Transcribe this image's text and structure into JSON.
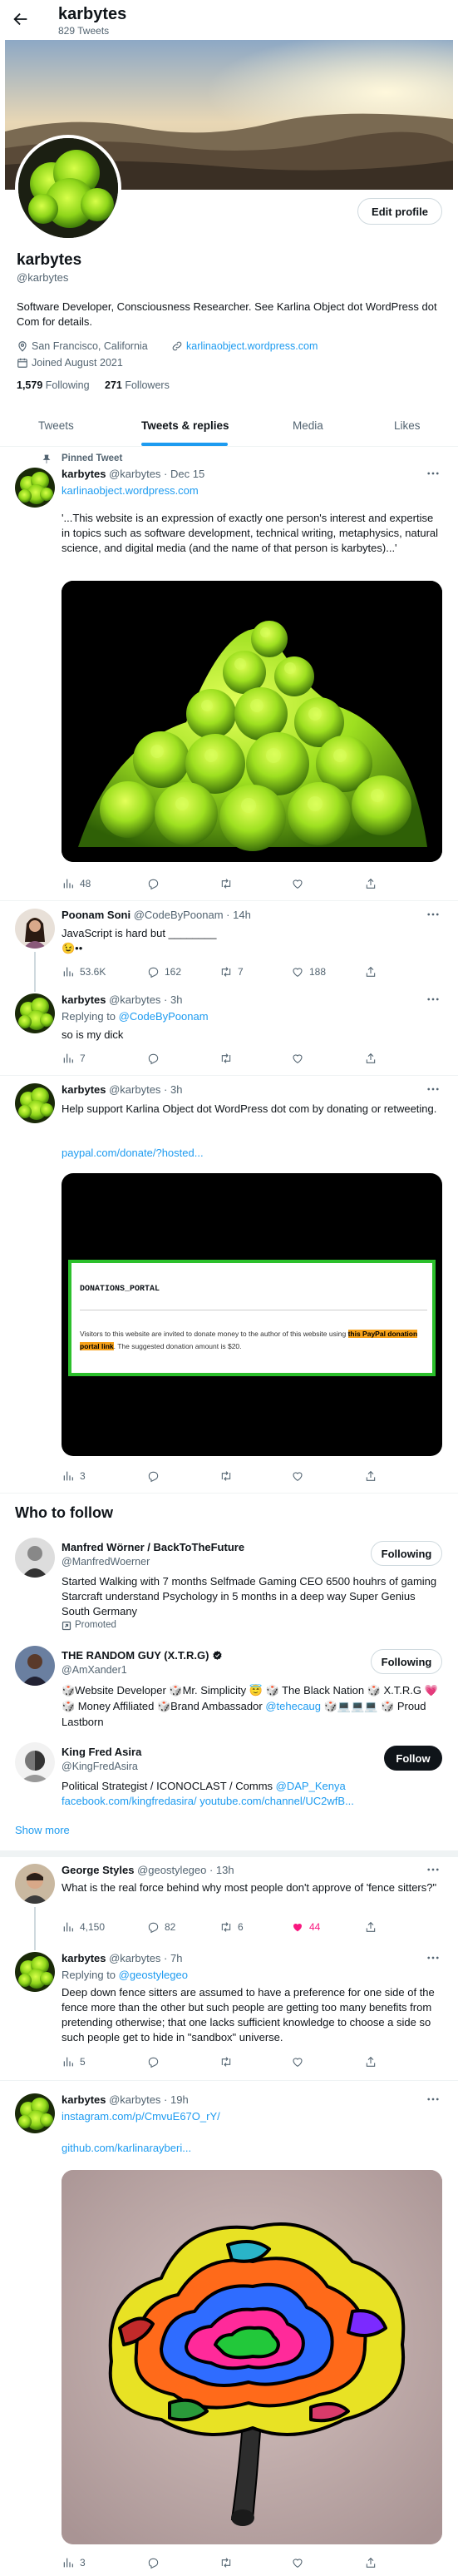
{
  "header": {
    "name": "karbytes",
    "tweet_count": "829 Tweets"
  },
  "profile": {
    "name": "karbytes",
    "handle": "@karbytes",
    "edit_label": "Edit profile",
    "bio": "Software Developer, Consciousness Researcher. See Karlina Object dot WordPress dot Com for details.",
    "location": "San Francisco, California",
    "website": "karlinaobject.wordpress.com",
    "joined": "Joined August 2021",
    "following_count": "1,579",
    "following_label": "Following",
    "followers_count": "271",
    "followers_label": "Followers"
  },
  "tabs": [
    "Tweets",
    "Tweets & replies",
    "Media",
    "Likes"
  ],
  "pinned": {
    "label": "Pinned Tweet",
    "name": "karbytes",
    "meta": "@karbytes · Dec 15",
    "link": "karlinaobject.wordpress.com",
    "text": "'...This website is an expression of exactly one person's interest and expertise in topics such as software development, technical writing, metaphysics, natural science, and digital media (and the name of that person is karbytes)...'",
    "views": "48"
  },
  "poonam": {
    "name": "Poonam Soni",
    "meta": "@CodeByPoonam · 14h",
    "text": "JavaScript is hard but ________",
    "emoji": "😉••",
    "views": "53.6K",
    "replies": "162",
    "retweets": "7",
    "likes": "188"
  },
  "reply1": {
    "name": "karbytes",
    "meta": "@karbytes · 3h",
    "replying_prefix": "Replying to",
    "replying_to": "@CodeByPoonam",
    "text": "so is my dick",
    "views": "7"
  },
  "donate": {
    "name": "karbytes",
    "meta": "@karbytes · 3h",
    "text": "Help support Karlina Object dot WordPress dot com by donating or retweeting.",
    "link": "paypal.com/donate/?hosted...",
    "card_title": "DONATIONS_PORTAL",
    "card_text_a": "Visitors to this website are invited to donate money to the author of this website using",
    "card_highlight": "this PayPal donation portal link",
    "card_text_b": ". The suggested donation amount is $20.",
    "views": "3"
  },
  "who_to_follow": {
    "title": "Who to follow",
    "show_more": "Show more",
    "users": [
      {
        "name": "Manfred Wörner / BackToTheFuture",
        "handle": "@ManfredWoerner",
        "button": "Following",
        "bio": "Started Walking with 7 months Selfmade Gaming CEO 6500 houhrs of gaming Starcraft understand Psychology in 5 months in a deep way Super Genius South Germany",
        "promoted": "Promoted"
      },
      {
        "name": "THE RANDOM GUY (X.T.R.G)",
        "handle": "@AmXander1",
        "button": "Following",
        "bio": "🎲Website Developer 🎲Mr. Simplicity 😇 🎲 The Black Nation 🎲 X.T.R.G 💗 🎲 Money Affiliated 🎲Brand Ambassador",
        "bio_link": "@tehecaug",
        "bio_tail": "🎲💻💻💻 🎲 Proud Lastborn"
      },
      {
        "name": "King Fred Asira",
        "handle": "@KingFredAsira",
        "button": "Follow",
        "bio": "Political Strategist / ICONOCLAST / Comms",
        "bio_link": "@DAP_Kenya facebook.com/kingfredasira/ youtube.com/channel/UC2wfB..."
      }
    ]
  },
  "george": {
    "name": "George Styles",
    "meta": "@geostylegeo · 13h",
    "text": "What is the real force behind why most people don't approve of 'fence sitters?\"",
    "views": "4,150",
    "replies": "82",
    "retweets": "6",
    "likes": "44"
  },
  "reply2": {
    "name": "karbytes",
    "meta": "@karbytes · 7h",
    "replying_prefix": "Replying to",
    "replying_to": "@geostylegeo",
    "text": "Deep down fence sitters are assumed to have a preference for one side of the fence more than the other but such people are getting too many benefits from pretending otherwise; that one lacks sufficient knowledge to choose a side so such people get to hide in \"sandbox\" universe.",
    "views": "5"
  },
  "last": {
    "name": "karbytes",
    "meta": "@karbytes · 19h",
    "link1": "instagram.com/p/CmvuE67O_rY/",
    "link2": "github.com/karlinarayberi...",
    "views": "3"
  },
  "colors": {
    "accent": "#1d9bf0",
    "like": "#f91880",
    "card_border": "#2cc02c",
    "highlight": "#f7a21b"
  }
}
